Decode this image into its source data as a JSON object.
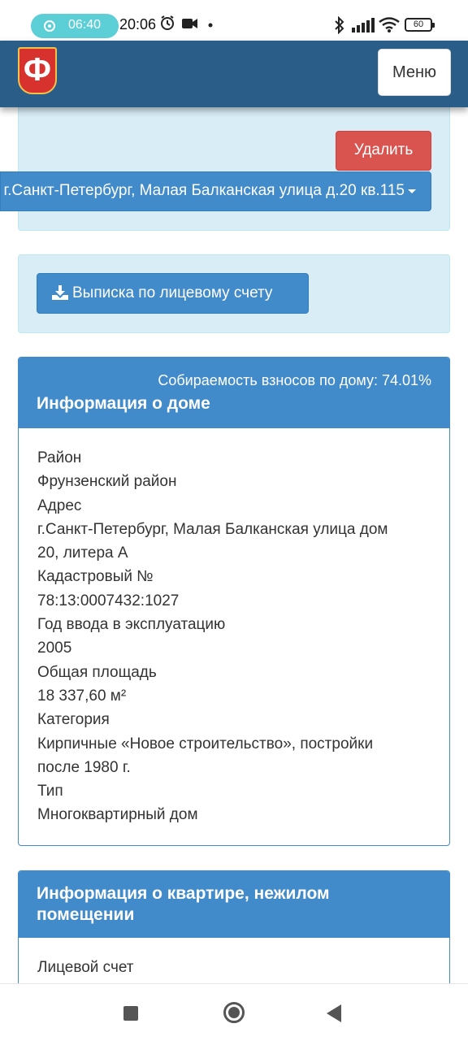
{
  "status_bar": {
    "recording_time": "06:40",
    "clock": "20:06",
    "battery": "60"
  },
  "navbar": {
    "logo_letter": "Ф",
    "menu_label": "Меню"
  },
  "account_panel": {
    "delete_label": "Удалить",
    "account_address": "г.Санкт-Петербург, Малая Балканская улица д.20 кв.115"
  },
  "statement_panel": {
    "statement_label": "Выписка по лицевому счету"
  },
  "house_info": {
    "collection_rate": "Собираемость взносов по дому: 74.01%",
    "title": "Информация о доме",
    "district_label": "Район",
    "district_value": "Фрунзенский район",
    "address_label": "Адрес",
    "address_value_line1": "г.Санкт-Петербург, Малая Балканская улица дом",
    "address_value_line2": "20, литера А",
    "cadastral_label": "Кадастровый №",
    "cadastral_value": "78:13:0007432:1027",
    "year_label": "Год ввода в эксплуатацию",
    "year_value": "2005",
    "area_label": "Общая площадь",
    "area_value": "18 337,60 м²",
    "category_label": "Категория",
    "category_value_line1": "Кирпичные «Новое строительство», постройки",
    "category_value_line2": "после 1980 г.",
    "type_label": "Тип",
    "type_value": "Многоквартирный дом"
  },
  "apartment_info": {
    "title_line1": "Информация о квартире, нежилом",
    "title_line2": "помещении",
    "account_label": "Лицевой счет"
  },
  "colors": {
    "navbar": "#2a5d87",
    "primary": "#428bca",
    "danger": "#d9534f",
    "info_panel_bg": "#d9edf7"
  }
}
